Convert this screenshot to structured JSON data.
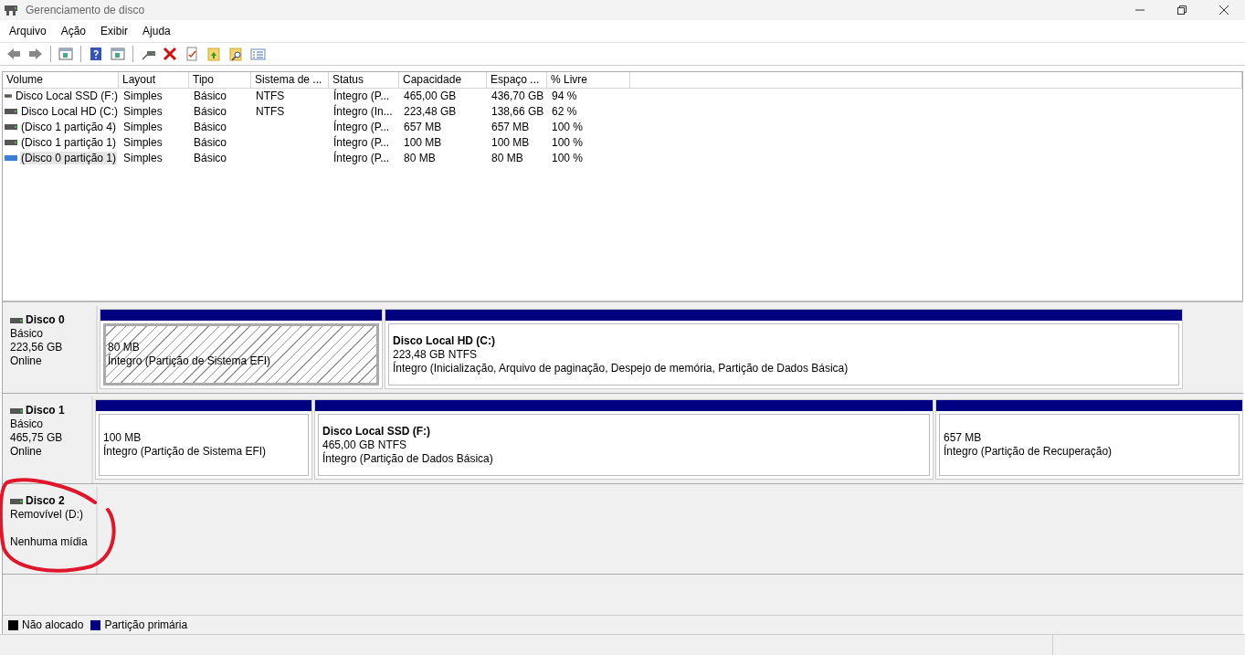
{
  "window": {
    "title": "Gerenciamento de disco"
  },
  "menu": [
    "Arquivo",
    "Ação",
    "Exibir",
    "Ajuda"
  ],
  "volume_table": {
    "columns": [
      "Volume",
      "Layout",
      "Tipo",
      "Sistema de ...",
      "Status",
      "Capacidade",
      "Espaço ...",
      "% Livre"
    ],
    "rows": [
      {
        "cells": [
          "Disco Local SSD (F:)",
          "Simples",
          "Básico",
          "NTFS",
          "Íntegro (P...",
          "465,00 GB",
          "436,70 GB",
          "94 %"
        ],
        "selected": false
      },
      {
        "cells": [
          "Disco Local HD (C:)",
          "Simples",
          "Básico",
          "NTFS",
          "Íntegro (In...",
          "223,48 GB",
          "138,66 GB",
          "62 %"
        ],
        "selected": false
      },
      {
        "cells": [
          "(Disco 1 partição 4)",
          "Simples",
          "Básico",
          "",
          "Íntegro (P...",
          "657 MB",
          "657 MB",
          "100 %"
        ],
        "selected": false
      },
      {
        "cells": [
          "(Disco 1 partição 1)",
          "Simples",
          "Básico",
          "",
          "Íntegro (P...",
          "100 MB",
          "100 MB",
          "100 %"
        ],
        "selected": false
      },
      {
        "cells": [
          "(Disco 0 partição 1)",
          "Simples",
          "Básico",
          "",
          "Íntegro (P...",
          "80 MB",
          "80 MB",
          "100 %"
        ],
        "selected": true
      }
    ]
  },
  "disks": [
    {
      "name": "Disco 0",
      "lines": [
        "Básico",
        "223,56 GB",
        "Online"
      ],
      "partitions": [
        {
          "size": "80 MB",
          "status": "Íntegro (Partição de Sistema EFI)",
          "selected": true
        },
        {
          "title": "Disco Local HD  (C:)",
          "size": "223,48 GB NTFS",
          "status": "Íntegro (Inicialização, Arquivo de paginação, Despejo de memória, Partição de Dados Básica)",
          "selected": false
        }
      ]
    },
    {
      "name": "Disco 1",
      "lines": [
        "Básico",
        "465,75 GB",
        "Online"
      ],
      "partitions": [
        {
          "size": "100 MB",
          "status": "Íntegro (Partição de Sistema EFI)",
          "selected": false
        },
        {
          "title": "Disco Local SSD  (F:)",
          "size": "465,00 GB NTFS",
          "status": "Íntegro (Partição de Dados Básica)",
          "selected": false
        },
        {
          "size": "657 MB",
          "status": "Íntegro (Partição de Recuperação)",
          "selected": false
        }
      ]
    },
    {
      "name": "Disco 2",
      "kind": "removable",
      "lines": [
        "Removível (D:)",
        "Nenhuma mídia"
      ]
    }
  ],
  "legend": [
    {
      "label": "Não alocado",
      "color": "#000000"
    },
    {
      "label": "Partição primária",
      "color": "#000080"
    }
  ]
}
